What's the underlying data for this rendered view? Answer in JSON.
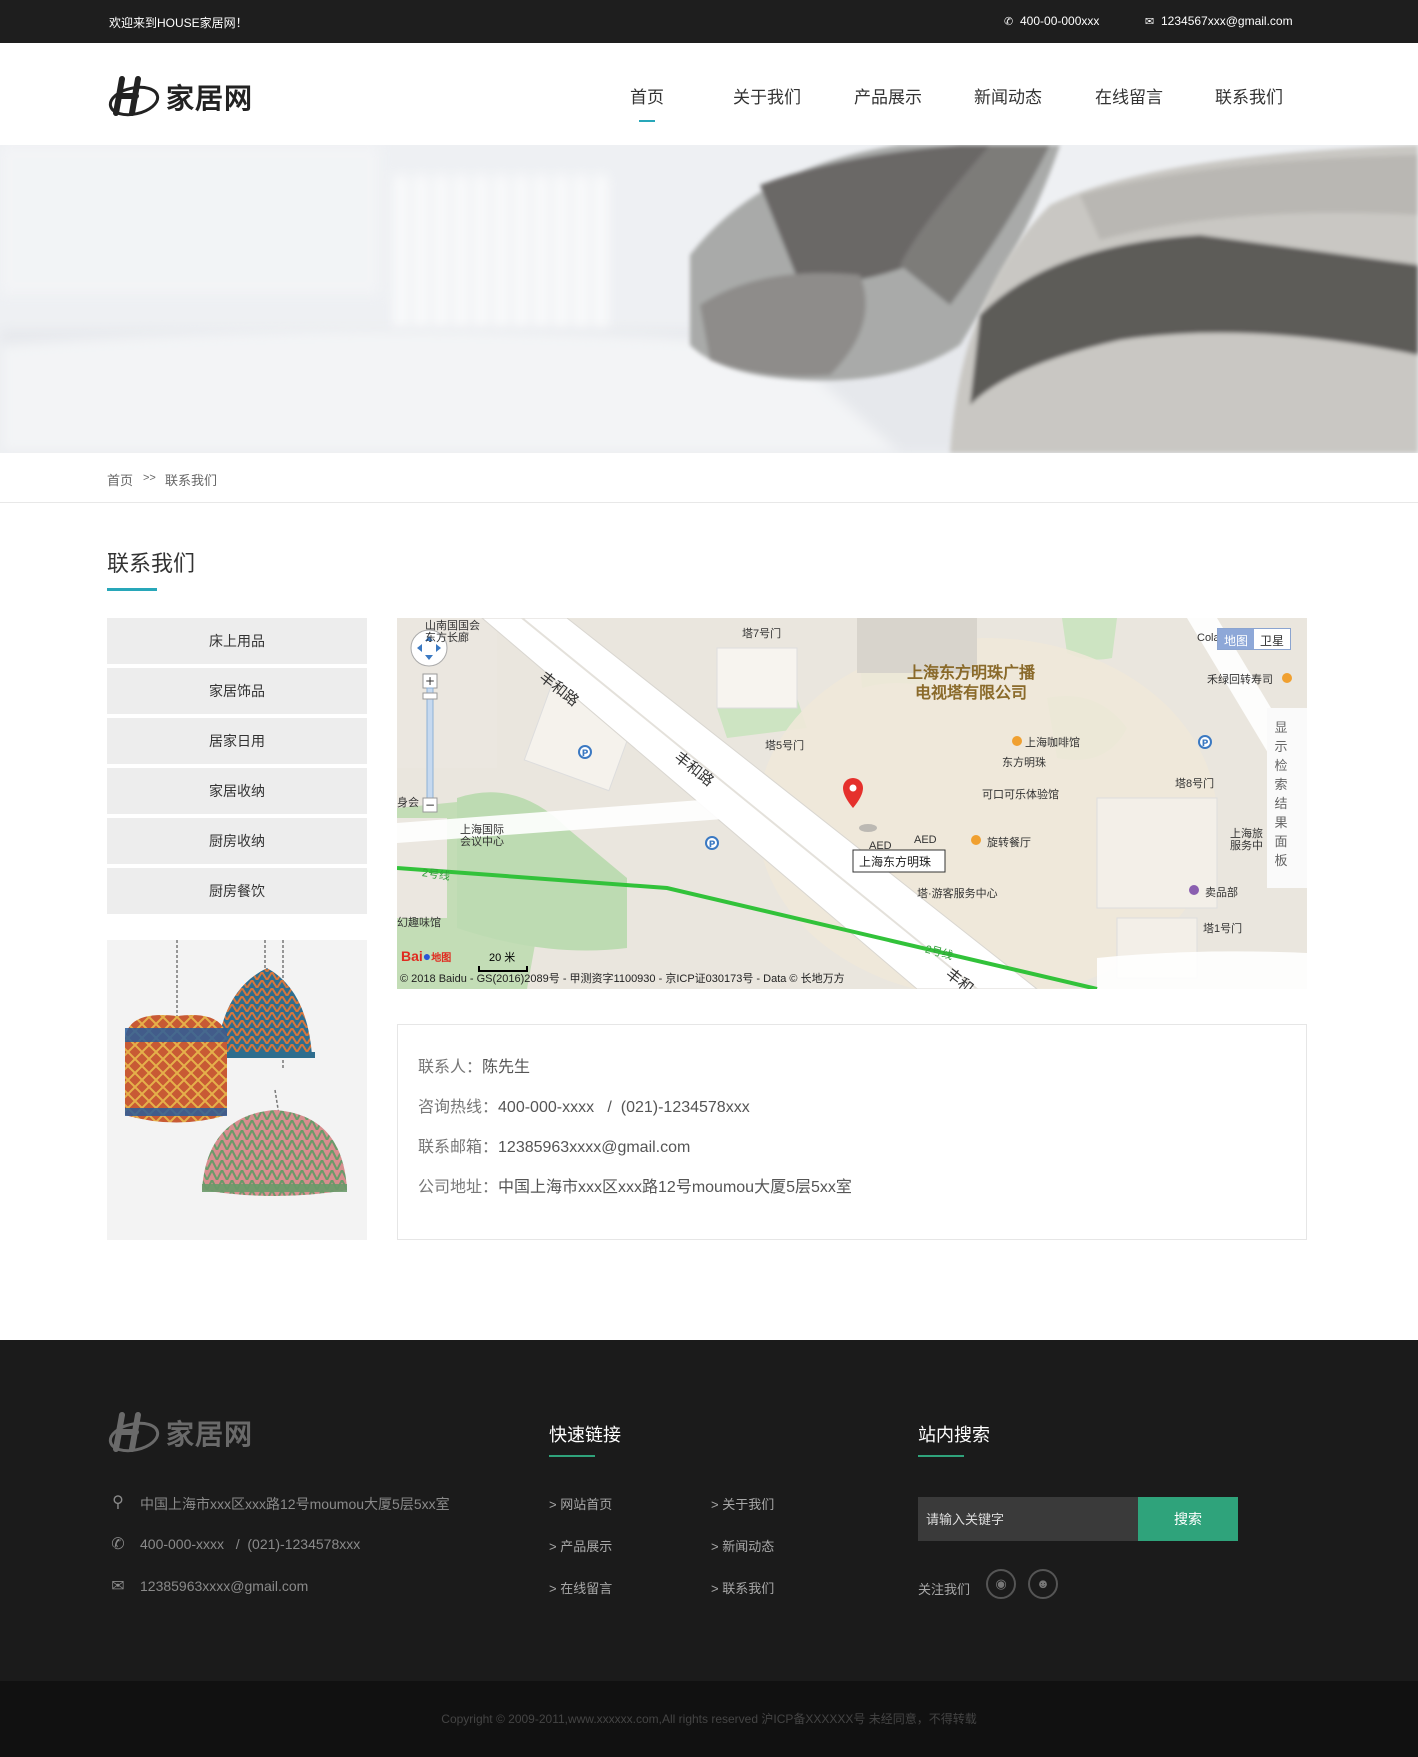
{
  "topbar": {
    "welcome": "欢迎来到HOUSE家居网！",
    "phone": "400-00-000xxx",
    "email": "1234567xxx@gmail.com"
  },
  "header": {
    "logo_text": "家居网",
    "nav": [
      "首页",
      "关于我们",
      "产品展示",
      "新闻动态",
      "在线留言",
      "联系我们"
    ]
  },
  "breadcrumb": {
    "home": "首页",
    "sep": ">>",
    "current": "联系我们"
  },
  "section": {
    "title": "联系我们"
  },
  "sidebar": {
    "items": [
      "床上用品",
      "家居饰品",
      "居家日用",
      "家居收纳",
      "厨房收纳",
      "厨房餐饮"
    ]
  },
  "map": {
    "tabs": [
      "地图",
      "卫星"
    ],
    "labels": {
      "tower": "上海东方明珠广播",
      "tower2": "电视塔有限公司",
      "road1": "丰和路",
      "road2": "丰和路",
      "road3": "丰和",
      "poi_pin": "上海东方明珠",
      "coffee": "上海咖啡馆",
      "dfmz": "东方明珠",
      "cola": "可口可乐体验馆",
      "rotating": "旋转餐厅",
      "tourist": "塔·游客服务中心",
      "gate7": "塔7号门",
      "gate5": "塔5号门",
      "gate8": "塔8号门",
      "gate1": "塔1号门",
      "conf": "上海国际",
      "conf2": "会议中心",
      "shop": "卖品部",
      "sushi": "禾绿回转寿司",
      "cola_top": "Cola",
      "travel": "上海旅",
      "travel2": "服务中",
      "line2a": "2号线",
      "line2b": "2号线",
      "aed1": "AED",
      "aed2": "AED",
      "show_panel": "显示检索结果面板",
      "scale": "20 米",
      "corner1": "山南国国会",
      "corner2": "东方长廊",
      "body": "身会",
      "fun": "幻趣味馆"
    },
    "copyright": "© 2018 Baidu - GS(2016)2089号 - 甲测资字1100930 - 京ICP证030173号 - Data © 长地万方",
    "baidu": "Bai",
    "baidu_map": "地图"
  },
  "contact": {
    "person_label": "联系人：",
    "person": "陈先生",
    "phone_label": "咨询热线：",
    "phone": "400-000-xxxx   /  (021)-1234578xxx",
    "email_label": "联系邮箱：",
    "email": "12385963xxxx@gmail.com",
    "address_label": "公司地址：",
    "address": "中国上海市xxx区xxx路12号moumou大厦5层5xx室"
  },
  "footer": {
    "logo_text": "家居网",
    "address": "中国上海市xxx区xxx路12号moumou大厦5层5xx室",
    "phone": "400-000-xxxx   /  (021)-1234578xxx",
    "email": "12385963xxxx@gmail.com",
    "quick_title": "快速链接",
    "links": [
      "> 网站首页",
      "> 关于我们",
      "> 产品展示",
      "> 新闻动态",
      "> 在线留言",
      "> 联系我们"
    ],
    "search_title": "站内搜索",
    "search_placeholder": "请输入关键字",
    "search_button": "搜索",
    "follow": "关注我们"
  },
  "copyright": "Copyright © 2009-2011,www.xxxxxx.com,All rights reserved  沪ICP备XXXXXX号 未经同意，不得转载",
  "colors": {
    "accent": "#28a7b9",
    "footer_green": "#2fa37b",
    "topbar": "#1e1e1e",
    "footer": "#1b1b1b"
  }
}
